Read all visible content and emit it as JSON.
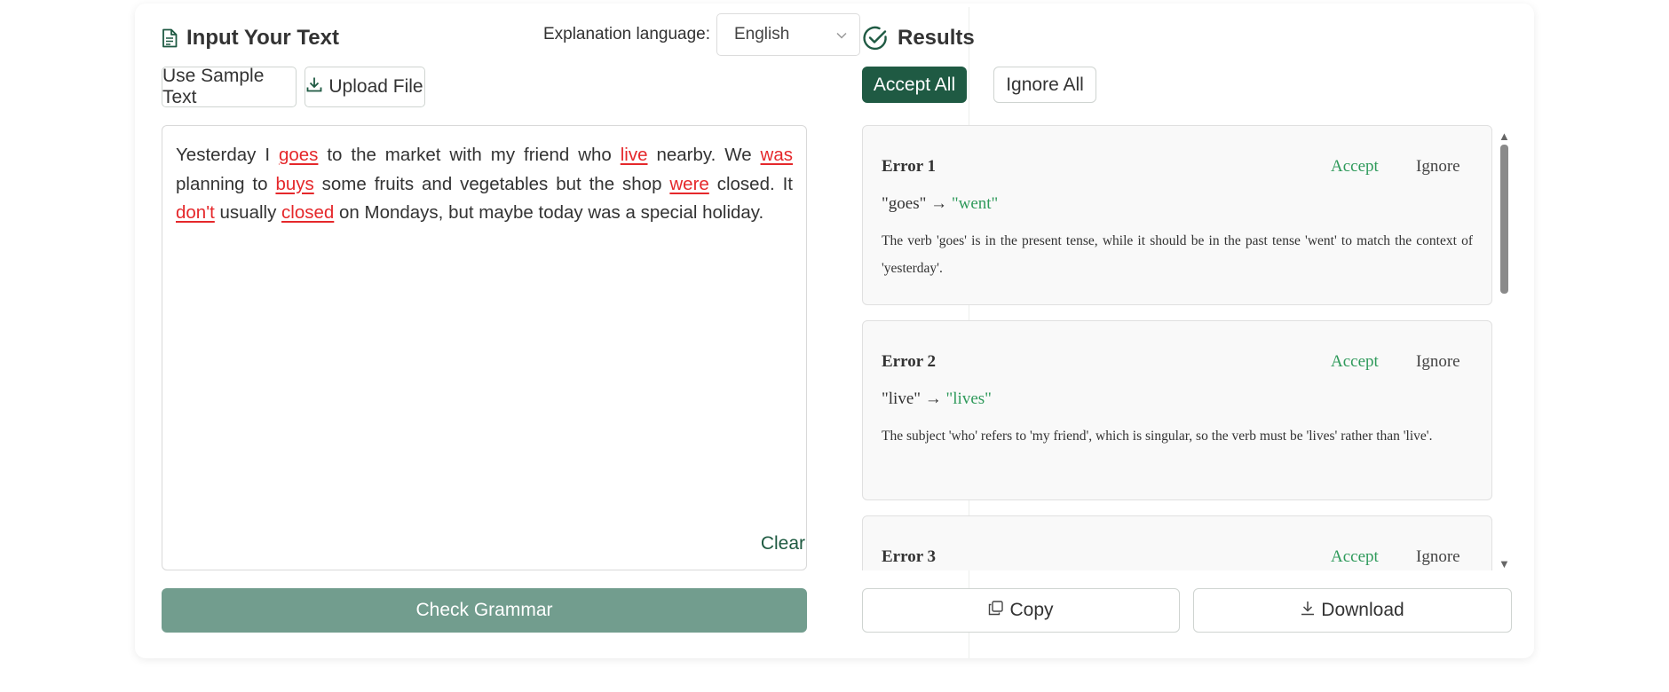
{
  "input": {
    "title": "Input Your Text",
    "language_label": "Explanation language:",
    "language_value": "English",
    "sample_button": "Use Sample Text",
    "upload_button": "Upload File",
    "text_segments": [
      {
        "t": "Yesterday I ",
        "err": false
      },
      {
        "t": "goes",
        "err": true
      },
      {
        "t": " to the market with my friend who ",
        "err": false
      },
      {
        "t": "live",
        "err": true
      },
      {
        "t": " nearby. We ",
        "err": false
      },
      {
        "t": "was",
        "err": true
      },
      {
        "t": " planning to ",
        "err": false
      },
      {
        "t": "buys",
        "err": true
      },
      {
        "t": " some fruits and vegetables but the shop ",
        "err": false
      },
      {
        "t": "were",
        "err": true
      },
      {
        "t": " closed. It ",
        "err": false
      },
      {
        "t": "don't",
        "err": true
      },
      {
        "t": " usually ",
        "err": false
      },
      {
        "t": "closed",
        "err": true
      },
      {
        "t": " on Mondays, but maybe today was a special holiday.",
        "err": false
      }
    ],
    "clear_label": "Clear",
    "check_button": "Check Grammar"
  },
  "results": {
    "title": "Results",
    "accept_all": "Accept All",
    "ignore_all": "Ignore All",
    "errors": [
      {
        "heading": "Error 1",
        "accept": "Accept",
        "ignore": "Ignore",
        "original": "\"goes\"",
        "arrow": "→",
        "suggestion": "\"went\"",
        "explanation": "The verb 'goes' is in the present tense, while it should be in the past tense 'went' to match the context of 'yesterday'."
      },
      {
        "heading": "Error 2",
        "accept": "Accept",
        "ignore": "Ignore",
        "original": "\"live\"",
        "arrow": "→",
        "suggestion": "\"lives\"",
        "explanation": "The subject 'who' refers to 'my friend', which is singular, so the verb must be 'lives' rather than 'live'."
      },
      {
        "heading": "Error 3",
        "accept": "Accept",
        "ignore": "Ignore",
        "original": "",
        "arrow": "",
        "suggestion": "",
        "explanation": ""
      }
    ],
    "copy_button": "Copy",
    "download_button": "Download"
  },
  "colors": {
    "brand_dark": "#1f5a43",
    "check_button": "#729d8e",
    "error_red": "#e5282b",
    "suggestion_green": "#2f9a5b"
  },
  "icons": {
    "title": "document-icon",
    "language_select": "chevron-down-icon",
    "upload": "download-icon",
    "results": "check-circle-icon",
    "copy": "copy-icon",
    "download": "download-icon"
  }
}
